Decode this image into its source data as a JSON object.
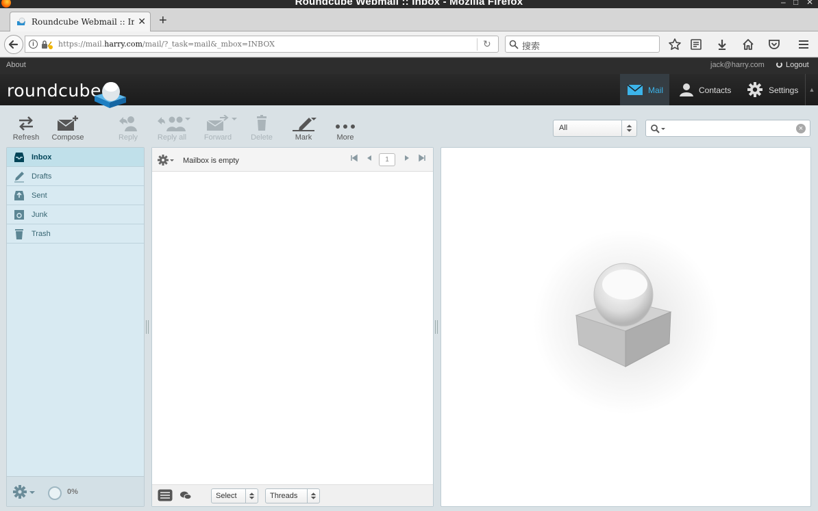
{
  "window": {
    "title": "Roundcube Webmail :: Inbox - Mozilla Firefox",
    "minimize": "‒",
    "maximize": "□",
    "close": "✕"
  },
  "browser": {
    "tab_title": "Roundcube Webmail :: In···",
    "tab_close": "✕",
    "new_tab": "+",
    "url_prefix": "https://mail.",
    "url_domain": "harry.com",
    "url_suffix": "/mail/?_task=mail&_mbox=INBOX",
    "search_placeholder": "搜索",
    "reload": "↻"
  },
  "topline": {
    "about": "About",
    "user": "jack@harry.com",
    "logout": "Logout"
  },
  "app": {
    "logo_text": "roundcube"
  },
  "topnav": {
    "mail": "Mail",
    "contacts": "Contacts",
    "settings": "Settings",
    "collapse": "▲"
  },
  "toolbar": {
    "refresh": "Refresh",
    "compose": "Compose",
    "reply": "Reply",
    "reply_all": "Reply all",
    "forward": "Forward",
    "delete": "Delete",
    "mark": "Mark",
    "more": "More"
  },
  "search": {
    "filter_value": "All",
    "reset": "×"
  },
  "folders": [
    {
      "name": "Inbox",
      "icon": "inbox-icon",
      "selected": true
    },
    {
      "name": "Drafts",
      "icon": "pencil-icon",
      "selected": false
    },
    {
      "name": "Sent",
      "icon": "sent-icon",
      "selected": false
    },
    {
      "name": "Junk",
      "icon": "junk-icon",
      "selected": false
    },
    {
      "name": "Trash",
      "icon": "trash-icon",
      "selected": false
    }
  ],
  "quota": {
    "percent": 0,
    "label": "0%"
  },
  "messagelist": {
    "status": "Mailbox is empty",
    "page": "1",
    "select_label": "Select",
    "threads_label": "Threads"
  },
  "colors": {
    "accent": "#3cb4ea",
    "folder_bg": "#d8eaf2",
    "selected_folder_bg": "#c0e0ea",
    "header_bg": "#1b1b1b"
  }
}
